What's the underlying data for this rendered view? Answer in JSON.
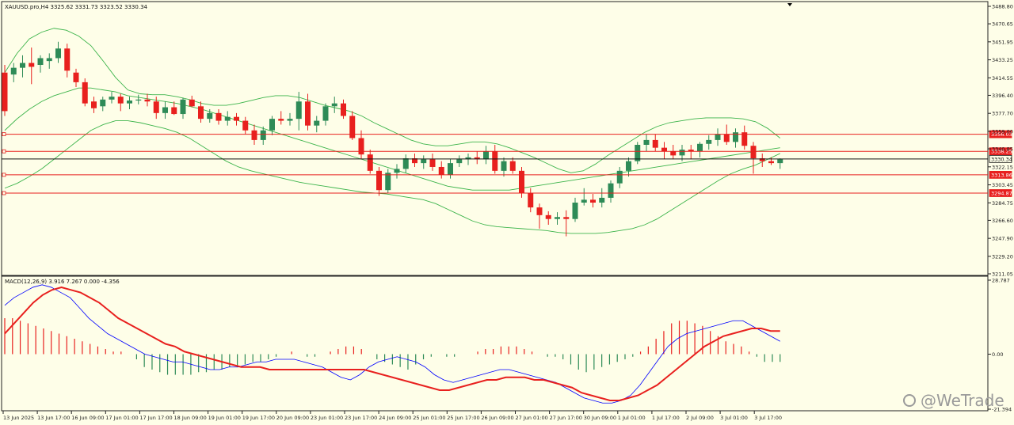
{
  "header": {
    "symbol_line": "XAUUSD.pro,H4  3325.62 3331.73 3323.52 3330.34"
  },
  "macd": {
    "label": "MACD(12,26,9) 3.916 7.267 0.000 -4.356",
    "axis_labels": [
      "28.787",
      "0.00",
      "-21.394"
    ]
  },
  "price_axis": {
    "labels": [
      "3488.80",
      "3470.65",
      "3451.95",
      "3433.25",
      "3414.55",
      "3396.40",
      "3377.70",
      "3359.00",
      "3340.85",
      "3322.15",
      "3303.45",
      "3284.75",
      "3266.60",
      "3247.90",
      "3229.20",
      "3211.05"
    ]
  },
  "level_lines": [
    {
      "label": "3356.03",
      "color": "#e8201e"
    },
    {
      "label": "3338.25",
      "color": "#e8201e"
    },
    {
      "label": "3330.34",
      "color": "#111111"
    },
    {
      "label": "3313.86",
      "color": "#e8201e"
    },
    {
      "label": "3294.87",
      "color": "#e8201e"
    }
  ],
  "time_axis": {
    "labels": [
      "13 Jun 2025",
      "13 Jun 17:00",
      "16 Jun 09:00",
      "17 Jun 01:00",
      "17 Jun 17:00",
      "18 Jun 09:00",
      "19 Jun 01:00",
      "19 Jun 17:00",
      "20 Jun 09:00",
      "23 Jun 01:00",
      "23 Jun 17:00",
      "24 Jun 09:00",
      "25 Jun 01:00",
      "25 Jun 17:00",
      "26 Jun 09:00",
      "27 Jun 01:00",
      "27 Jun 17:00",
      "30 Jun 09:00",
      "1 Jul 01:00",
      "1 Jul 17:00",
      "2 Jul 09:00",
      "3 Jul 01:00",
      "3 Jul 17:00"
    ]
  },
  "watermark": {
    "text": "@WeTrade"
  },
  "colors": {
    "bull": "#2e8b57",
    "bear": "#e8201e",
    "band": "#3cb44b",
    "macd_line": "#0000ff",
    "signal": "#e8201e"
  },
  "chart_data": {
    "type": "candlestick",
    "candles": [
      [
        3420,
        3428,
        3375,
        3380
      ],
      [
        3418,
        3430,
        3410,
        3425
      ],
      [
        3425,
        3438,
        3415,
        3430
      ],
      [
        3430,
        3446,
        3408,
        3426
      ],
      [
        3428,
        3438,
        3420,
        3435
      ],
      [
        3432,
        3440,
        3424,
        3435
      ],
      [
        3435,
        3452,
        3430,
        3445
      ],
      [
        3445,
        3450,
        3415,
        3422
      ],
      [
        3420,
        3424,
        3405,
        3410
      ],
      [
        3410,
        3414,
        3385,
        3388
      ],
      [
        3390,
        3395,
        3378,
        3383
      ],
      [
        3385,
        3395,
        3380,
        3392
      ],
      [
        3392,
        3400,
        3388,
        3395
      ],
      [
        3395,
        3398,
        3380,
        3388
      ],
      [
        3388,
        3395,
        3382,
        3391
      ],
      [
        3391,
        3397,
        3387,
        3392
      ],
      [
        3392,
        3398,
        3385,
        3390
      ],
      [
        3390,
        3395,
        3372,
        3378
      ],
      [
        3378,
        3390,
        3372,
        3384
      ],
      [
        3384,
        3390,
        3376,
        3377
      ],
      [
        3377,
        3394,
        3372,
        3392
      ],
      [
        3392,
        3396,
        3384,
        3385
      ],
      [
        3385,
        3390,
        3368,
        3372
      ],
      [
        3372,
        3382,
        3368,
        3378
      ],
      [
        3378,
        3382,
        3366,
        3370
      ],
      [
        3370,
        3380,
        3365,
        3374
      ],
      [
        3374,
        3378,
        3365,
        3370
      ],
      [
        3370,
        3374,
        3356,
        3360
      ],
      [
        3360,
        3366,
        3345,
        3350
      ],
      [
        3350,
        3364,
        3345,
        3360
      ],
      [
        3360,
        3375,
        3355,
        3372
      ],
      [
        3372,
        3380,
        3366,
        3370
      ],
      [
        3370,
        3378,
        3365,
        3372
      ],
      [
        3372,
        3400,
        3360,
        3390
      ],
      [
        3390,
        3398,
        3360,
        3365
      ],
      [
        3365,
        3375,
        3358,
        3370
      ],
      [
        3370,
        3388,
        3365,
        3385
      ],
      [
        3385,
        3395,
        3378,
        3388
      ],
      [
        3388,
        3392,
        3372,
        3375
      ],
      [
        3375,
        3380,
        3350,
        3352
      ],
      [
        3352,
        3360,
        3330,
        3335
      ],
      [
        3335,
        3340,
        3315,
        3318
      ],
      [
        3318,
        3322,
        3292,
        3298
      ],
      [
        3298,
        3320,
        3295,
        3316
      ],
      [
        3316,
        3325,
        3310,
        3320
      ],
      [
        3320,
        3335,
        3316,
        3331
      ],
      [
        3331,
        3336,
        3322,
        3326
      ],
      [
        3326,
        3334,
        3320,
        3330
      ],
      [
        3330,
        3336,
        3318,
        3322
      ],
      [
        3322,
        3328,
        3310,
        3314
      ],
      [
        3314,
        3330,
        3310,
        3326
      ],
      [
        3326,
        3334,
        3322,
        3330
      ],
      [
        3330,
        3336,
        3324,
        3332
      ],
      [
        3332,
        3338,
        3325,
        3330
      ],
      [
        3330,
        3344,
        3325,
        3338
      ],
      [
        3338,
        3345,
        3315,
        3318
      ],
      [
        3318,
        3332,
        3312,
        3328
      ],
      [
        3328,
        3332,
        3315,
        3318
      ],
      [
        3318,
        3322,
        3290,
        3295
      ],
      [
        3295,
        3300,
        3275,
        3280
      ],
      [
        3280,
        3284,
        3258,
        3272
      ],
      [
        3272,
        3276,
        3262,
        3268
      ],
      [
        3268,
        3275,
        3262,
        3270
      ],
      [
        3270,
        3277,
        3250,
        3268
      ],
      [
        3268,
        3290,
        3265,
        3285
      ],
      [
        3285,
        3300,
        3282,
        3288
      ],
      [
        3288,
        3294,
        3280,
        3285
      ],
      [
        3285,
        3300,
        3280,
        3290
      ],
      [
        3290,
        3308,
        3285,
        3305
      ],
      [
        3305,
        3322,
        3300,
        3318
      ],
      [
        3318,
        3332,
        3312,
        3328
      ],
      [
        3328,
        3348,
        3325,
        3345
      ],
      [
        3345,
        3356,
        3338,
        3350
      ],
      [
        3350,
        3356,
        3338,
        3342
      ],
      [
        3342,
        3348,
        3330,
        3338
      ],
      [
        3338,
        3345,
        3330,
        3334
      ],
      [
        3334,
        3345,
        3328,
        3340
      ],
      [
        3340,
        3345,
        3330,
        3338
      ],
      [
        3338,
        3348,
        3332,
        3346
      ],
      [
        3346,
        3355,
        3340,
        3350
      ],
      [
        3350,
        3362,
        3344,
        3356
      ],
      [
        3356,
        3366,
        3345,
        3348
      ],
      [
        3348,
        3362,
        3342,
        3358
      ],
      [
        3358,
        3365,
        3340,
        3344
      ],
      [
        3344,
        3348,
        3315,
        3331
      ],
      [
        3331,
        3336,
        3322,
        3328
      ],
      [
        3328,
        3332,
        3324,
        3326
      ],
      [
        3326,
        3331,
        3320,
        3330
      ]
    ],
    "upper_band": [
      3420,
      3440,
      3455,
      3462,
      3466,
      3464,
      3458,
      3448,
      3432,
      3415,
      3402,
      3398,
      3397,
      3397,
      3395,
      3392,
      3388,
      3386,
      3386,
      3388,
      3391,
      3394,
      3396,
      3396,
      3394,
      3390,
      3386,
      3383,
      3380,
      3375,
      3368,
      3362,
      3356,
      3350,
      3346,
      3344,
      3344,
      3346,
      3348,
      3348,
      3346,
      3342,
      3337,
      3332,
      3326,
      3320,
      3316,
      3318,
      3325,
      3334,
      3342,
      3350,
      3358,
      3364,
      3368,
      3370,
      3372,
      3373,
      3373,
      3373,
      3372,
      3369,
      3362,
      3352
    ],
    "lower_band": [
      3300,
      3305,
      3312,
      3320,
      3330,
      3340,
      3350,
      3360,
      3366,
      3370,
      3370,
      3368,
      3365,
      3362,
      3358,
      3352,
      3344,
      3336,
      3328,
      3322,
      3318,
      3315,
      3312,
      3309,
      3306,
      3304,
      3302,
      3300,
      3298,
      3296,
      3295,
      3294,
      3292,
      3290,
      3288,
      3284,
      3278,
      3272,
      3266,
      3262,
      3260,
      3259,
      3258,
      3257,
      3256,
      3254,
      3253,
      3253,
      3253,
      3254,
      3256,
      3258,
      3262,
      3268,
      3276,
      3284,
      3292,
      3300,
      3308,
      3315,
      3320,
      3324,
      3330,
      3336
    ],
    "middle_band": [
      3360,
      3372,
      3382,
      3390,
      3396,
      3400,
      3404,
      3404,
      3402,
      3400,
      3396,
      3394,
      3392,
      3390,
      3388,
      3385,
      3382,
      3378,
      3374,
      3370,
      3366,
      3362,
      3358,
      3354,
      3350,
      3346,
      3342,
      3338,
      3334,
      3330,
      3326,
      3322,
      3318,
      3314,
      3310,
      3306,
      3302,
      3300,
      3298,
      3298,
      3298,
      3298,
      3300,
      3302,
      3304,
      3306,
      3308,
      3310,
      3312,
      3314,
      3316,
      3318,
      3320,
      3322,
      3324,
      3326,
      3328,
      3330,
      3332,
      3334,
      3336,
      3338,
      3340,
      3342
    ],
    "macd_histogram": [
      14,
      14,
      13,
      12,
      11,
      10,
      9,
      8,
      7,
      6,
      5,
      4,
      3,
      2,
      1,
      1,
      0,
      -2,
      -5,
      -6,
      -7,
      -8,
      -8,
      -8,
      -8,
      -7,
      -7,
      -6,
      -6,
      -5,
      -5,
      -4,
      -3,
      -3,
      -2,
      -1,
      0,
      1,
      0,
      -1,
      -1,
      0,
      1,
      2,
      3,
      3,
      2,
      0,
      -2,
      -3,
      -4,
      -5,
      -6,
      -4,
      -2,
      -1,
      0,
      -1,
      -1,
      0,
      0,
      1,
      2,
      2,
      3,
      3,
      3,
      2,
      1,
      0,
      -1,
      -1,
      -2,
      -4,
      -6,
      -7,
      -6,
      -5,
      -4,
      -3,
      -2,
      -1,
      1,
      3,
      6,
      9,
      12,
      13,
      13,
      12,
      11,
      9,
      7,
      5,
      4,
      3,
      1,
      -1,
      -3,
      -3,
      -3
    ],
    "macd_line": [
      19,
      22,
      24,
      26,
      27,
      26,
      24,
      22,
      18,
      14,
      11,
      8,
      6,
      4,
      2,
      0,
      -1,
      -2,
      -3,
      -3,
      -4,
      -5,
      -6,
      -6,
      -5,
      -5,
      -4,
      -3,
      -3,
      -2,
      -2,
      -2,
      -3,
      -4,
      -5,
      -7,
      -9,
      -10,
      -8,
      -5,
      -3,
      -2,
      -1,
      -2,
      -3,
      -5,
      -8,
      -10,
      -11,
      -10,
      -9,
      -8,
      -7,
      -6,
      -6,
      -7,
      -8,
      -9,
      -10,
      -11,
      -13,
      -15,
      -17,
      -18,
      -19,
      -19,
      -18,
      -16,
      -12,
      -7,
      -2,
      3,
      6,
      8,
      9,
      10,
      11,
      12,
      13,
      13,
      11,
      9,
      7,
      5
    ],
    "signal_line": [
      8,
      12,
      16,
      20,
      23,
      25,
      26,
      25,
      24,
      22,
      20,
      17,
      14,
      12,
      10,
      8,
      6,
      4,
      3,
      1,
      0,
      -1,
      -2,
      -3,
      -4,
      -5,
      -5,
      -5,
      -6,
      -6,
      -6,
      -6,
      -6,
      -6,
      -6,
      -6,
      -6,
      -6,
      -6,
      -7,
      -8,
      -9,
      -10,
      -11,
      -12,
      -13,
      -14,
      -14,
      -13,
      -12,
      -11,
      -10,
      -10,
      -9,
      -9,
      -9,
      -10,
      -10,
      -11,
      -12,
      -13,
      -15,
      -16,
      -17,
      -18,
      -18,
      -17,
      -16,
      -14,
      -12,
      -9,
      -6,
      -3,
      0,
      3,
      5,
      7,
      8,
      9,
      10,
      10,
      9,
      9
    ]
  }
}
